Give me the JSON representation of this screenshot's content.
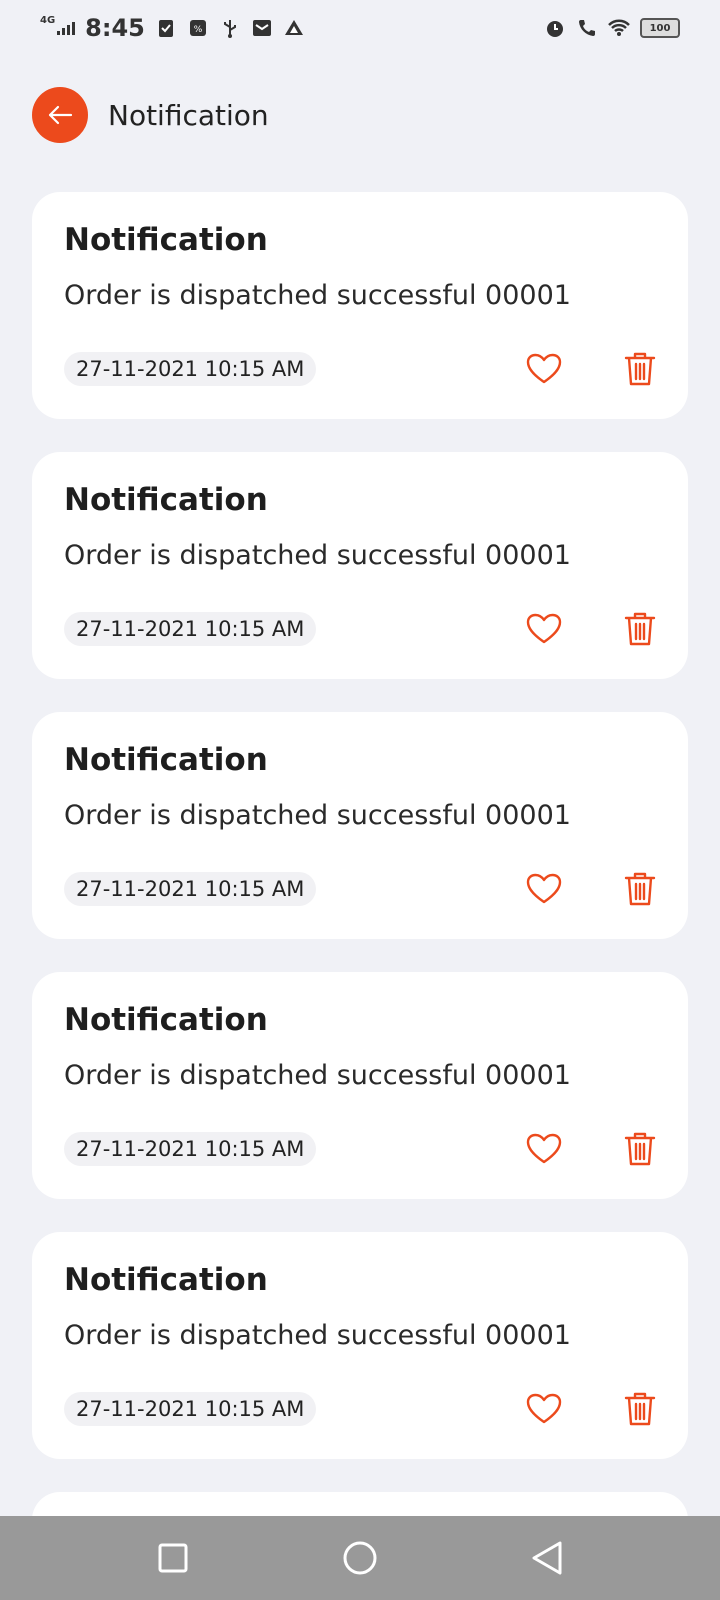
{
  "status_bar": {
    "time": "8:45",
    "network": "4G",
    "battery": "100"
  },
  "header": {
    "title": "Notification"
  },
  "notifications": [
    {
      "title": "Notification",
      "message": "Order is dispatched successful 00001",
      "timestamp": "27-11-2021 10:15 AM"
    },
    {
      "title": "Notification",
      "message": "Order is dispatched successful 00001",
      "timestamp": "27-11-2021 10:15 AM"
    },
    {
      "title": "Notification",
      "message": "Order is dispatched successful 00001",
      "timestamp": "27-11-2021 10:15 AM"
    },
    {
      "title": "Notification",
      "message": "Order is dispatched successful 00001",
      "timestamp": "27-11-2021 10:15 AM"
    },
    {
      "title": "Notification",
      "message": "Order is dispatched successful 00001",
      "timestamp": "27-11-2021 10:15 AM"
    }
  ],
  "colors": {
    "accent": "#ec4a1c",
    "background": "#f0f1f6",
    "card": "#ffffff",
    "nav_bar": "#999999"
  },
  "icons": {
    "back": "arrow-left-icon",
    "like": "heart-icon",
    "delete": "trash-icon",
    "nav_recents": "square-icon",
    "nav_home": "circle-icon",
    "nav_back": "triangle-back-icon"
  }
}
